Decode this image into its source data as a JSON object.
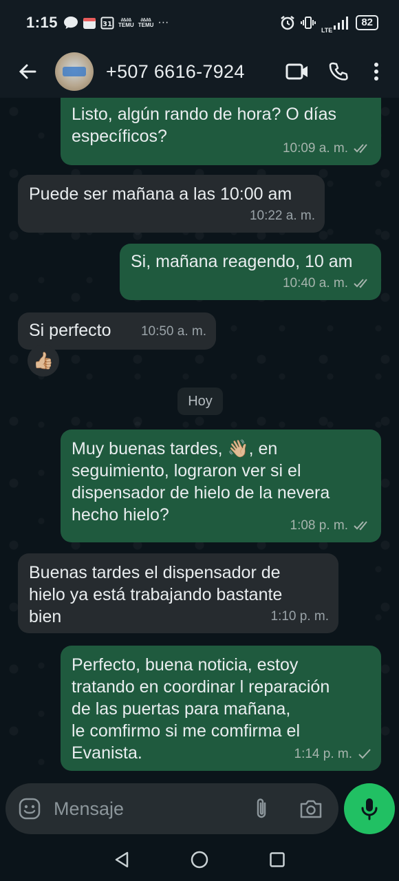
{
  "status_bar": {
    "time": "1:15",
    "temu_label_1": "TEMU",
    "temu_label_2": "TEMU",
    "more": "···",
    "battery": "82",
    "network": "LTE"
  },
  "header": {
    "contact_name": "+507 6616-7924",
    "icons": [
      "back-arrow-icon",
      "video-call-icon",
      "phone-icon",
      "more-vert-icon"
    ]
  },
  "messages": [
    {
      "direction": "out",
      "text": "Listo, algún rando de hora? O días\nespecíficos?",
      "time": "10:09 a. m.",
      "status": "read"
    },
    {
      "direction": "in",
      "text": "Puede ser mañana a las 10:00 am",
      "time": "10:22 a. m."
    },
    {
      "direction": "out",
      "text": "Si, mañana reagendo, 10 am",
      "time": "10:40 a. m.",
      "status": "read"
    },
    {
      "direction": "in",
      "text": "Si perfecto",
      "time": "10:50 a. m.",
      "reaction": "👍🏼"
    },
    {
      "direction": "out",
      "text": "Muy buenas tardes, 👋🏼, en\nseguimiento, lograron ver si el\ndispensador de hielo de la nevera\nhecho hielo?",
      "time": "1:08 p. m.",
      "status": "read"
    },
    {
      "direction": "in",
      "text": "Buenas tardes el dispensador de\nhielo ya está trabajando bastante\nbien",
      "time": "1:10 p. m."
    },
    {
      "direction": "out",
      "text": "Perfecto, buena noticia, estoy\ntratando en coordinar l reparación\nde las puertas para mañana,\nle comfirmo si me comfirma el\nEvanista.",
      "time": "1:14 p. m.",
      "status": "sent"
    }
  ],
  "day_divider": "Hoy",
  "input": {
    "placeholder": "Mensaje"
  },
  "colors": {
    "outgoing_bubble": "#1f5a3e",
    "incoming_bubble": "#262b2f",
    "mic_button": "#21c063",
    "background": "#0b141a"
  }
}
